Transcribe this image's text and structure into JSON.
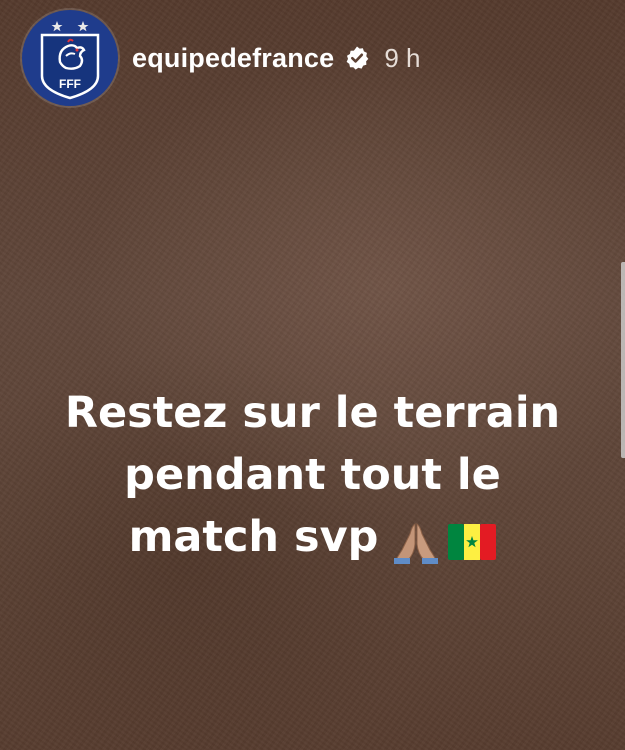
{
  "story": {
    "account": {
      "username": "equipedefrance",
      "verified": true,
      "time_ago": "9 h",
      "avatar_text": "FFF"
    },
    "caption": {
      "lines": [
        "Restez sur le terrain",
        "pendant tout le",
        "match svp"
      ],
      "emojis": [
        "folded-hands-emoji",
        "senegal-flag-emoji"
      ]
    },
    "colors": {
      "background": "#5c4134",
      "avatar_blue": "#1f3c8c",
      "text": "#ffffff",
      "senegal_green": "#00853f",
      "senegal_yellow": "#fdef42",
      "senegal_red": "#e31b23"
    }
  }
}
